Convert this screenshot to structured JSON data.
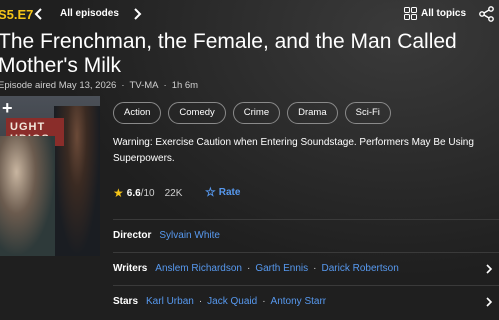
{
  "topbar": {
    "episode_code": "S5.E7",
    "all_episodes_label": "All episodes",
    "all_topics_label": "All topics"
  },
  "episode": {
    "title": "The Frenchman, the Female, and the Man Called Mother's Milk",
    "aired": "Episode aired May 13, 2026",
    "rating_code": "TV-MA",
    "duration": "1h 6m"
  },
  "genres": [
    "Action",
    "Comedy",
    "Crime",
    "Drama",
    "Sci-Fi"
  ],
  "warning": "Warning: Exercise Caution when Entering Soundstage. Performers May Be Using Superpowers.",
  "rating": {
    "score": "6.6",
    "out_of": "/10",
    "count": "22K",
    "rate_label": "Rate"
  },
  "credits": {
    "director": {
      "label": "Director",
      "names": [
        "Sylvain White"
      ]
    },
    "writers": {
      "label": "Writers",
      "names": [
        "Anslem Richardson",
        "Garth Ennis",
        "Darick Robertson"
      ]
    },
    "stars": {
      "label": "Stars",
      "names": [
        "Karl Urban",
        "Jack Quaid",
        "Antony Starr"
      ]
    }
  },
  "poster": {
    "sign_text": "UGHT\nUDIOS"
  },
  "colors": {
    "accent_yellow": "#f5c518",
    "link_blue": "#5799ef",
    "background": "#1f1f1f"
  }
}
